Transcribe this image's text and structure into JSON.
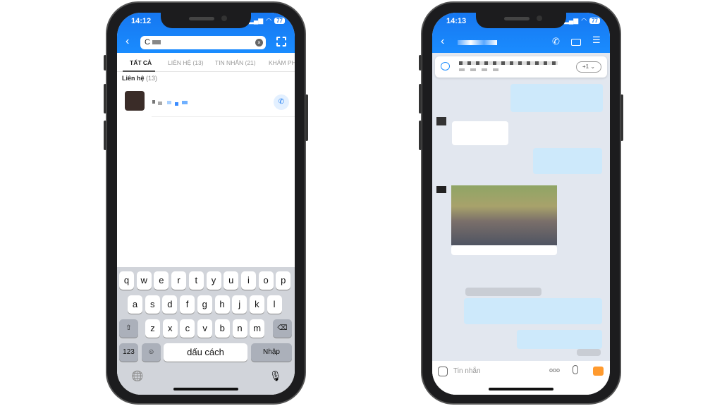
{
  "left": {
    "time": "14:12",
    "battery": "77",
    "search": {
      "value": "C"
    },
    "tabs": [
      "TẤT CẢ",
      "LIÊN HỆ (13)",
      "TIN NHẮN (21)",
      "KHÁM PHÁ"
    ],
    "section": {
      "label": "Liên hệ",
      "count": "(13)"
    },
    "keyboard": {
      "row1": [
        "q",
        "w",
        "e",
        "r",
        "t",
        "y",
        "u",
        "i",
        "o",
        "p"
      ],
      "row2": [
        "a",
        "s",
        "d",
        "f",
        "g",
        "h",
        "j",
        "k",
        "l"
      ],
      "row3": [
        "z",
        "x",
        "c",
        "v",
        "b",
        "n",
        "m"
      ],
      "num": "123",
      "space": "dấu cách",
      "enter": "Nhập"
    }
  },
  "right": {
    "time": "14:13",
    "battery": "77",
    "pinned_more": "+1",
    "input_placeholder": "Tin nhắn",
    "accent": "#1a8cff"
  }
}
